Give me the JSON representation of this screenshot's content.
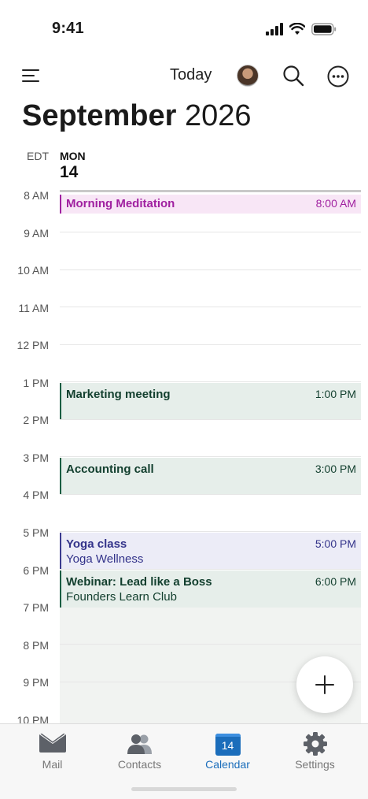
{
  "status": {
    "time": "9:41"
  },
  "toolbar": {
    "today_label": "Today"
  },
  "title": {
    "month": "September",
    "year": "2026"
  },
  "day_header": {
    "timezone": "EDT",
    "day_name": "MON",
    "day_number": "14"
  },
  "hours": [
    "8 AM",
    "9 AM",
    "10 AM",
    "11 AM",
    "12 PM",
    "1 PM",
    "2 PM",
    "3 PM",
    "4 PM",
    "5 PM",
    "6 PM",
    "7 PM",
    "8 PM",
    "9 PM",
    "10 PM"
  ],
  "events": [
    {
      "title": "Morning Meditation",
      "time": "8:00 AM",
      "subtitle": "",
      "color": "#a020a0"
    },
    {
      "title": "Marketing meeting",
      "time": "1:00 PM",
      "subtitle": "",
      "color": "#1b5e43"
    },
    {
      "title": "Accounting call",
      "time": "3:00 PM",
      "subtitle": "",
      "color": "#1b5e43"
    },
    {
      "title": "Yoga class",
      "time": "5:00 PM",
      "subtitle": "Yoga Wellness",
      "color": "#3b3b8f"
    },
    {
      "title": "Webinar: Lead like a Boss",
      "time": "6:00 PM",
      "subtitle": "Founders Learn Club",
      "color": "#1b5e43"
    }
  ],
  "tabs": [
    {
      "label": "Mail",
      "icon": "mail-icon",
      "active": false
    },
    {
      "label": "Contacts",
      "icon": "contacts-icon",
      "active": false
    },
    {
      "label": "Calendar",
      "icon": "calendar-icon",
      "badge": "14",
      "active": true
    },
    {
      "label": "Settings",
      "icon": "gear-icon",
      "active": false
    }
  ],
  "colors": {
    "accent": "#1b6dbb",
    "tab_inactive": "#777777"
  }
}
